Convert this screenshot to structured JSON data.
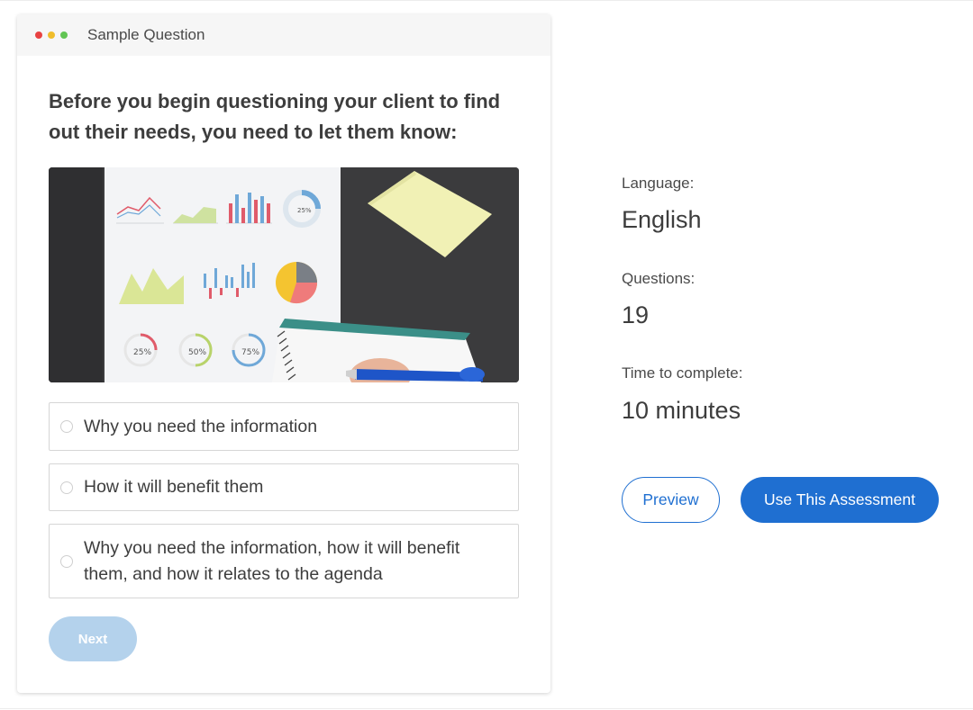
{
  "window": {
    "title": "Sample Question",
    "dot_colors": [
      "#e84242",
      "#f0bd2b",
      "#62c554"
    ]
  },
  "question": {
    "text": "Before you begin questioning your client to find out their needs, you need to let them know:",
    "image_printed_values": [
      "25%",
      "50%",
      "75%",
      "25%"
    ],
    "options": [
      {
        "label": "Why you need the information",
        "selected": false
      },
      {
        "label": "How it will benefit them",
        "selected": false
      },
      {
        "label": "Why you need the information, how it will benefit them, and how it relates to the agenda",
        "selected": false
      }
    ],
    "next_label": "Next",
    "next_disabled": true
  },
  "details": {
    "language_label": "Language:",
    "language_value": "English",
    "questions_label": "Questions:",
    "questions_value": "19",
    "time_label": "Time to complete:",
    "time_value": "10 minutes"
  },
  "actions": {
    "preview_label": "Preview",
    "use_label": "Use This Assessment"
  },
  "colors": {
    "accent": "#1f6fd1",
    "next_disabled": "#b4d2ec"
  }
}
